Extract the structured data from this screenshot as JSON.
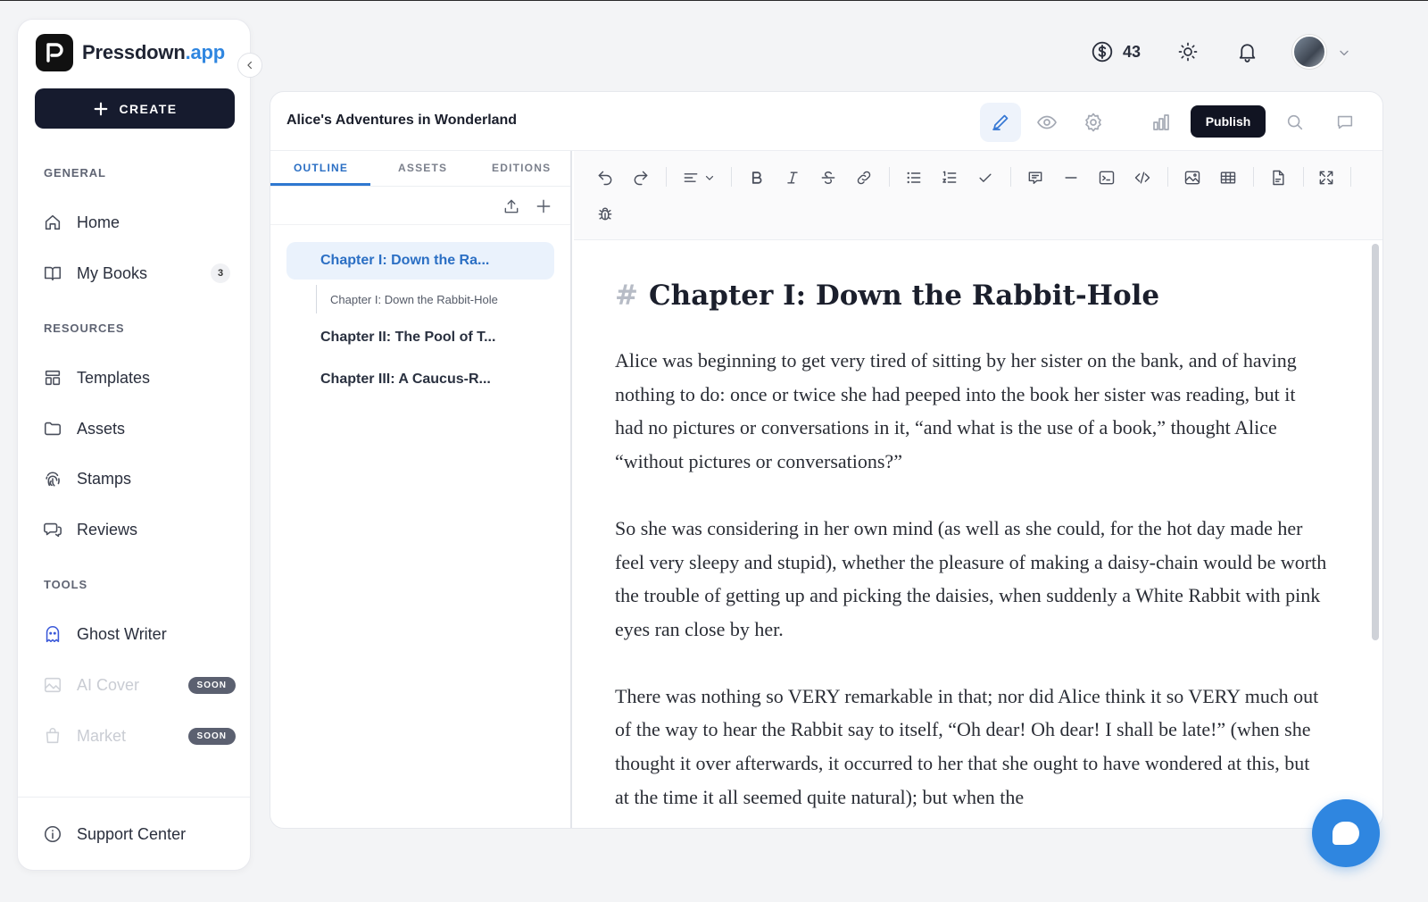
{
  "brand": {
    "name": "Pressdown",
    "suffix": ".app",
    "accent": "#2f86e0"
  },
  "sidebar": {
    "create_label": "CREATE",
    "sections": {
      "general": "GENERAL",
      "resources": "RESOURCES",
      "tools": "TOOLS"
    },
    "items": {
      "home": "Home",
      "my_books": "My Books",
      "my_books_count": "3",
      "templates": "Templates",
      "assets": "Assets",
      "stamps": "Stamps",
      "reviews": "Reviews",
      "ghost_writer": "Ghost Writer",
      "ai_cover": "AI Cover",
      "market": "Market",
      "soon": "SOON",
      "support": "Support Center"
    }
  },
  "topbar": {
    "credits": "43"
  },
  "editor": {
    "book_title": "Alice's Adventures in Wonderland",
    "publish_label": "Publish",
    "tabs": [
      "OUTLINE",
      "ASSETS",
      "EDITIONS"
    ],
    "outline": {
      "chapters": [
        "Chapter I: Down the Ra...",
        "Chapter II: The Pool of T...",
        "Chapter III: A Caucus-R..."
      ],
      "sub_heading": "Chapter I: Down the Rabbit-Hole"
    },
    "document": {
      "heading_marker": "#",
      "heading": "Chapter I: Down the Rabbit-Hole",
      "paragraphs": [
        "Alice was beginning to get very tired of sitting by her sister on the bank, and of having nothing to do: once or twice she had peeped into the book her sister was reading, but it had no pictures or conversations in it, “and what is the use of a book,” thought Alice “without pictures or conversations?”",
        "So she was considering in her own mind (as well as she could, for the hot day made her feel very sleepy and stupid), whether the pleasure of making a daisy-chain would be worth the trouble of getting up and picking the daisies, when suddenly a White Rabbit with pink eyes ran close by her.",
        "There was nothing so VERY remarkable in that; nor did Alice think it so VERY much out of the way to hear the Rabbit say to itself, “Oh dear! Oh dear! I shall be late!” (when she thought it over afterwards, it occurred to her that she ought to have wondered at this, but at the time it all seemed quite natural); but when the"
      ]
    }
  }
}
